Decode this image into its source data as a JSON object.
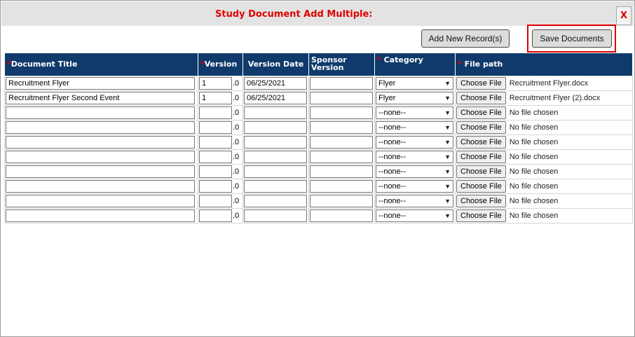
{
  "dialog": {
    "title": "Study Document Add Multiple:",
    "close_label": "X"
  },
  "toolbar": {
    "add_label": "Add New Record(s)",
    "save_label": "Save Documents"
  },
  "columns": {
    "title": "Document Title",
    "version": "Version",
    "version_date": "Version Date",
    "sponsor_line1": "Sponsor",
    "sponsor_line2": "Version",
    "category": "Category",
    "file_path": "File path",
    "required_mark": "*"
  },
  "version_suffix": ".0",
  "choose_file_label": "Choose File",
  "rows": [
    {
      "title": "Recruitment Flyer",
      "version": "1",
      "date": "06/25/2021",
      "sponsor": "",
      "category": "Flyer",
      "file": "Recruitment Flyer.docx"
    },
    {
      "title": "Recruitment Flyer Second Event",
      "version": "1",
      "date": "06/25/2021",
      "sponsor": "",
      "category": "Flyer",
      "file": "Recruitment Flyer (2).docx"
    },
    {
      "title": "",
      "version": "",
      "date": "",
      "sponsor": "",
      "category": "--none--",
      "file": "No file chosen"
    },
    {
      "title": "",
      "version": "",
      "date": "",
      "sponsor": "",
      "category": "--none--",
      "file": "No file chosen"
    },
    {
      "title": "",
      "version": "",
      "date": "",
      "sponsor": "",
      "category": "--none--",
      "file": "No file chosen"
    },
    {
      "title": "",
      "version": "",
      "date": "",
      "sponsor": "",
      "category": "--none--",
      "file": "No file chosen"
    },
    {
      "title": "",
      "version": "",
      "date": "",
      "sponsor": "",
      "category": "--none--",
      "file": "No file chosen"
    },
    {
      "title": "",
      "version": "",
      "date": "",
      "sponsor": "",
      "category": "--none--",
      "file": "No file chosen"
    },
    {
      "title": "",
      "version": "",
      "date": "",
      "sponsor": "",
      "category": "--none--",
      "file": "No file chosen"
    },
    {
      "title": "",
      "version": "",
      "date": "",
      "sponsor": "",
      "category": "--none--",
      "file": "No file chosen"
    }
  ],
  "colors": {
    "header_bg": "#0f3a6b",
    "title_red": "#e00000",
    "highlight": "#e00000"
  }
}
